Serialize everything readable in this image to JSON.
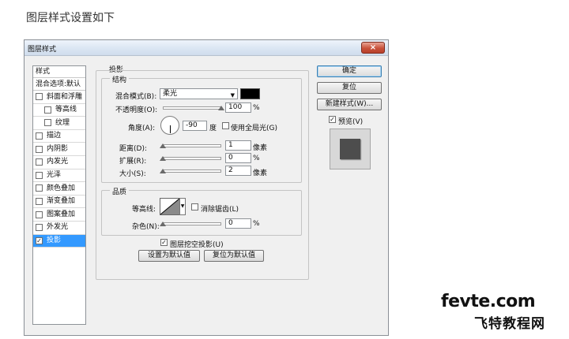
{
  "caption": "图层样式设置如下",
  "window": {
    "title": "图层样式",
    "close_glyph": "×"
  },
  "styles_panel": {
    "header": "样式",
    "blend_options": "混合选项:默认",
    "items": [
      {
        "label": "斜面和浮雕",
        "checked": false
      },
      {
        "label": "等高线",
        "checked": false,
        "sub": true
      },
      {
        "label": "纹理",
        "checked": false,
        "sub": true
      },
      {
        "label": "描边",
        "checked": false
      },
      {
        "label": "内阴影",
        "checked": false
      },
      {
        "label": "内发光",
        "checked": false
      },
      {
        "label": "光泽",
        "checked": false
      },
      {
        "label": "颜色叠加",
        "checked": false
      },
      {
        "label": "渐变叠加",
        "checked": false
      },
      {
        "label": "图案叠加",
        "checked": false
      },
      {
        "label": "外发光",
        "checked": false
      },
      {
        "label": "投影",
        "checked": true,
        "selected": true
      }
    ]
  },
  "shadow": {
    "section_title": "投影",
    "structure": {
      "title": "结构",
      "blend_mode_label": "混合模式(B):",
      "blend_mode_value": "柔光",
      "shadow_color": "#000000",
      "opacity_label": "不透明度(O):",
      "opacity_value": "100",
      "opacity_percent": 100,
      "percent_unit": "%",
      "angle_label": "角度(A):",
      "angle_value": "-90",
      "angle_unit": "度",
      "global_light_label": "使用全局光(G)",
      "global_light_checked": false,
      "distance_label": "距离(D):",
      "distance_value": "1",
      "spread_label": "扩展(R):",
      "spread_value": "0",
      "size_label": "大小(S):",
      "size_value": "2",
      "px_unit": "像素"
    },
    "quality": {
      "title": "品质",
      "contour_label": "等高线:",
      "antialias_label": "消除锯齿(L)",
      "antialias_checked": false,
      "noise_label": "杂色(N):",
      "noise_value": "0",
      "percent_unit": "%"
    },
    "knockout_label": "图层挖空投影(U)",
    "knockout_checked": true,
    "make_default_button": "设置为默认值",
    "reset_default_button": "复位为默认值"
  },
  "right_panel": {
    "ok_button": "确定",
    "reset_button": "复位",
    "new_style_button": "新建样式(W)...",
    "preview_label": "预览(V)",
    "preview_checked": true
  },
  "watermark": {
    "line1": "fevte.com",
    "line2": "飞特教程网"
  },
  "colors": {
    "selection": "#3399ff",
    "window_bg": "#f0f0f0"
  }
}
